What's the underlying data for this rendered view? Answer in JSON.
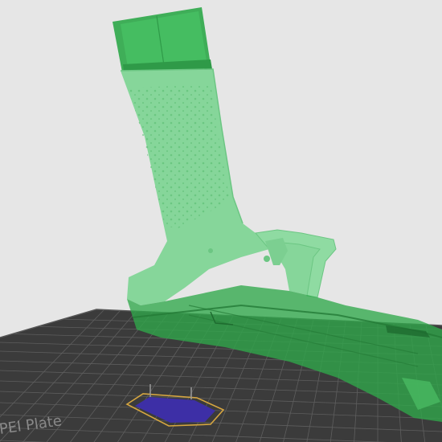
{
  "viewport": {
    "background": "#e6e6e6",
    "bed_color": "#3a3a3a",
    "grid_color": "#5b5b5b",
    "model_color": "#7bd28f",
    "model_dark_color": "#2f9a48",
    "highlight_color": "#2fa84a",
    "selection_color": "#3a2f9a"
  },
  "bed": {
    "label": "PEI Plate"
  },
  "model": {
    "icon": "pistol-model"
  }
}
